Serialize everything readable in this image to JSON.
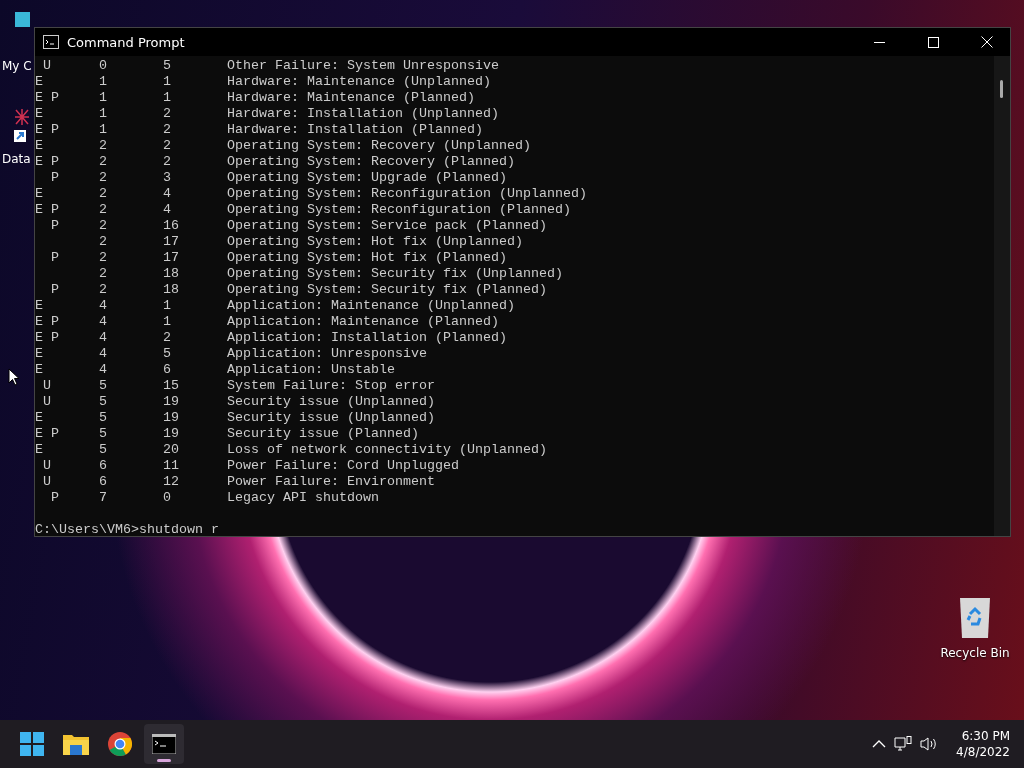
{
  "desktop": {
    "icons": [
      {
        "label": "My C",
        "kind": "monitor"
      },
      {
        "label": "Data",
        "kind": "shortcut"
      }
    ],
    "recycle_bin": {
      "label": "Recycle Bin"
    }
  },
  "window": {
    "title": "Command Prompt",
    "rows": [
      {
        "flags": " U",
        "major": "0",
        "minor": "5",
        "reason": "Other Failure: System Unresponsive"
      },
      {
        "flags": "E",
        "major": "1",
        "minor": "1",
        "reason": "Hardware: Maintenance (Unplanned)"
      },
      {
        "flags": "E P",
        "major": "1",
        "minor": "1",
        "reason": "Hardware: Maintenance (Planned)"
      },
      {
        "flags": "E",
        "major": "1",
        "minor": "2",
        "reason": "Hardware: Installation (Unplanned)"
      },
      {
        "flags": "E P",
        "major": "1",
        "minor": "2",
        "reason": "Hardware: Installation (Planned)"
      },
      {
        "flags": "E",
        "major": "2",
        "minor": "2",
        "reason": "Operating System: Recovery (Unplanned)"
      },
      {
        "flags": "E P",
        "major": "2",
        "minor": "2",
        "reason": "Operating System: Recovery (Planned)"
      },
      {
        "flags": "  P",
        "major": "2",
        "minor": "3",
        "reason": "Operating System: Upgrade (Planned)"
      },
      {
        "flags": "E",
        "major": "2",
        "minor": "4",
        "reason": "Operating System: Reconfiguration (Unplanned)"
      },
      {
        "flags": "E P",
        "major": "2",
        "minor": "4",
        "reason": "Operating System: Reconfiguration (Planned)"
      },
      {
        "flags": "  P",
        "major": "2",
        "minor": "16",
        "reason": "Operating System: Service pack (Planned)"
      },
      {
        "major": "2",
        "minor": "17",
        "reason": "Operating System: Hot fix (Unplanned)"
      },
      {
        "flags": "  P",
        "major": "2",
        "minor": "17",
        "reason": "Operating System: Hot fix (Planned)"
      },
      {
        "major": "2",
        "minor": "18",
        "reason": "Operating System: Security fix (Unplanned)"
      },
      {
        "flags": "  P",
        "major": "2",
        "minor": "18",
        "reason": "Operating System: Security fix (Planned)"
      },
      {
        "flags": "E",
        "major": "4",
        "minor": "1",
        "reason": "Application: Maintenance (Unplanned)"
      },
      {
        "flags": "E P",
        "major": "4",
        "minor": "1",
        "reason": "Application: Maintenance (Planned)"
      },
      {
        "flags": "E P",
        "major": "4",
        "minor": "2",
        "reason": "Application: Installation (Planned)"
      },
      {
        "flags": "E",
        "major": "4",
        "minor": "5",
        "reason": "Application: Unresponsive"
      },
      {
        "flags": "E",
        "major": "4",
        "minor": "6",
        "reason": "Application: Unstable"
      },
      {
        "flags": " U",
        "major": "5",
        "minor": "15",
        "reason": "System Failure: Stop error"
      },
      {
        "flags": " U",
        "major": "5",
        "minor": "19",
        "reason": "Security issue (Unplanned)"
      },
      {
        "flags": "E",
        "major": "5",
        "minor": "19",
        "reason": "Security issue (Unplanned)"
      },
      {
        "flags": "E P",
        "major": "5",
        "minor": "19",
        "reason": "Security issue (Planned)"
      },
      {
        "flags": "E",
        "major": "5",
        "minor": "20",
        "reason": "Loss of network connectivity (Unplanned)"
      },
      {
        "flags": " U",
        "major": "6",
        "minor": "11",
        "reason": "Power Failure: Cord Unplugged"
      },
      {
        "flags": " U",
        "major": "6",
        "minor": "12",
        "reason": "Power Failure: Environment"
      },
      {
        "flags": "  P",
        "major": "7",
        "minor": "0",
        "reason": "Legacy API shutdown"
      }
    ],
    "prompt": "C:\\Users\\VM6>shutdown r"
  },
  "taskbar": {
    "apps": [
      {
        "kind": "start",
        "selected": false
      },
      {
        "kind": "folder",
        "selected": false
      },
      {
        "kind": "browser",
        "selected": false
      },
      {
        "kind": "terminal",
        "selected": true
      }
    ],
    "time": "6:30 PM",
    "date": "4/8/2022"
  }
}
